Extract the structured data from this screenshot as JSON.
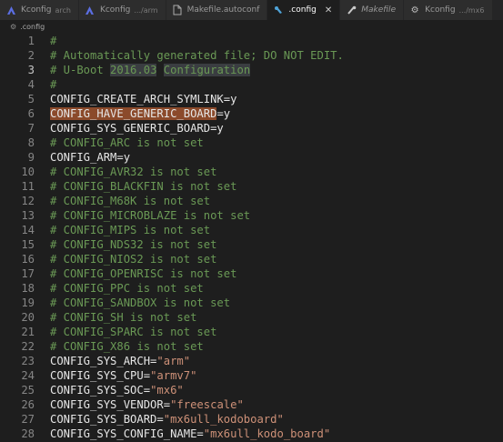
{
  "tabs": [
    {
      "label": "Kconfig",
      "dir": "arch",
      "icon": "kconfig-icon",
      "active": false
    },
    {
      "label": "Kconfig",
      "dir": ".../arm",
      "icon": "kconfig-icon",
      "active": false
    },
    {
      "label": "Makefile.autoconf",
      "dir": "",
      "icon": "file-icon",
      "active": false
    },
    {
      "label": ".config",
      "dir": "",
      "icon": "config-icon",
      "active": true,
      "close": "✕"
    },
    {
      "label": "Makefile",
      "dir": "",
      "icon": "makefile-icon",
      "active": false,
      "italic": true
    },
    {
      "label": "Kconfig",
      "dir": ".../mx6",
      "icon": "gear-icon",
      "active": false
    }
  ],
  "breadcrumb": {
    "label": ".config"
  },
  "editor": {
    "lines": [
      {
        "n": "1",
        "parts": [
          {
            "t": "#",
            "c": "comment"
          }
        ]
      },
      {
        "n": "2",
        "parts": [
          {
            "t": "# Automatically generated file; DO NOT EDIT.",
            "c": "comment"
          }
        ]
      },
      {
        "n": "3",
        "parts": [
          {
            "t": "# U-Boot ",
            "c": "comment"
          },
          {
            "t": "2016.03",
            "c": "comment",
            "hl": "word"
          },
          {
            "t": " ",
            "c": "comment"
          },
          {
            "t": "Configuration",
            "c": "comment",
            "hl": "word"
          }
        ],
        "current": true
      },
      {
        "n": "4",
        "parts": [
          {
            "t": "#",
            "c": "comment"
          }
        ]
      },
      {
        "n": "5",
        "parts": [
          {
            "t": "CONFIG_CREATE_ARCH_SYMLINK=y",
            "c": "plain"
          }
        ]
      },
      {
        "n": "6",
        "parts": [
          {
            "t": "CONFIG_HAVE_GENERIC_BOARD",
            "c": "plain",
            "hl": "sel"
          },
          {
            "t": "=y",
            "c": "plain"
          }
        ]
      },
      {
        "n": "7",
        "parts": [
          {
            "t": "CONFIG_SYS_GENERIC_BOARD=y",
            "c": "plain"
          }
        ]
      },
      {
        "n": "8",
        "parts": [
          {
            "t": "# CONFIG_ARC is not set",
            "c": "comment"
          }
        ]
      },
      {
        "n": "9",
        "parts": [
          {
            "t": "CONFIG_ARM=y",
            "c": "plain"
          }
        ]
      },
      {
        "n": "10",
        "parts": [
          {
            "t": "# CONFIG_AVR32 is not set",
            "c": "comment"
          }
        ]
      },
      {
        "n": "11",
        "parts": [
          {
            "t": "# CONFIG_BLACKFIN is not set",
            "c": "comment"
          }
        ]
      },
      {
        "n": "12",
        "parts": [
          {
            "t": "# CONFIG_M68K is not set",
            "c": "comment"
          }
        ]
      },
      {
        "n": "13",
        "parts": [
          {
            "t": "# CONFIG_MICROBLAZE is not set",
            "c": "comment"
          }
        ]
      },
      {
        "n": "14",
        "parts": [
          {
            "t": "# CONFIG_MIPS is not set",
            "c": "comment"
          }
        ]
      },
      {
        "n": "15",
        "parts": [
          {
            "t": "# CONFIG_NDS32 is not set",
            "c": "comment"
          }
        ]
      },
      {
        "n": "16",
        "parts": [
          {
            "t": "# CONFIG_NIOS2 is not set",
            "c": "comment"
          }
        ]
      },
      {
        "n": "17",
        "parts": [
          {
            "t": "# CONFIG_OPENRISC is not set",
            "c": "comment"
          }
        ]
      },
      {
        "n": "18",
        "parts": [
          {
            "t": "# CONFIG_PPC is not set",
            "c": "comment"
          }
        ]
      },
      {
        "n": "19",
        "parts": [
          {
            "t": "# CONFIG_SANDBOX is not set",
            "c": "comment"
          }
        ]
      },
      {
        "n": "20",
        "parts": [
          {
            "t": "# CONFIG_SH is not set",
            "c": "comment"
          }
        ]
      },
      {
        "n": "21",
        "parts": [
          {
            "t": "# CONFIG_SPARC is not set",
            "c": "comment"
          }
        ]
      },
      {
        "n": "22",
        "parts": [
          {
            "t": "# CONFIG_X86 is not set",
            "c": "comment"
          }
        ]
      },
      {
        "n": "23",
        "parts": [
          {
            "t": "CONFIG_SYS_ARCH=",
            "c": "plain"
          },
          {
            "t": "\"arm\"",
            "c": "string"
          }
        ]
      },
      {
        "n": "24",
        "parts": [
          {
            "t": "CONFIG_SYS_CPU=",
            "c": "plain"
          },
          {
            "t": "\"armv7\"",
            "c": "string"
          }
        ]
      },
      {
        "n": "25",
        "parts": [
          {
            "t": "CONFIG_SYS_SOC=",
            "c": "plain"
          },
          {
            "t": "\"mx6\"",
            "c": "string"
          }
        ]
      },
      {
        "n": "26",
        "parts": [
          {
            "t": "CONFIG_SYS_VENDOR=",
            "c": "plain"
          },
          {
            "t": "\"freescale\"",
            "c": "string"
          }
        ]
      },
      {
        "n": "27",
        "parts": [
          {
            "t": "CONFIG_SYS_BOARD=",
            "c": "plain"
          },
          {
            "t": "\"mx6ull_kodoboard\"",
            "c": "string"
          }
        ]
      },
      {
        "n": "28",
        "parts": [
          {
            "t": "CONFIG_SYS_CONFIG_NAME=",
            "c": "plain"
          },
          {
            "t": "\"mx6ull_kodo_board\"",
            "c": "string"
          }
        ]
      }
    ]
  }
}
